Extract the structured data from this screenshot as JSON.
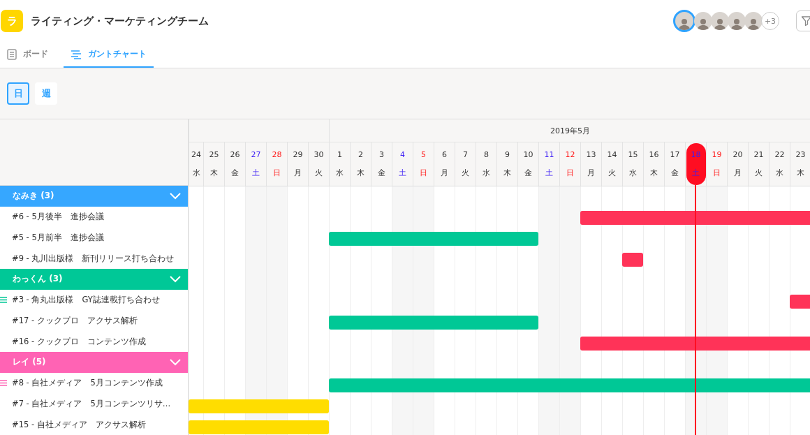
{
  "project": {
    "initial": "ラ",
    "title": "ライティング・マーケティングチーム"
  },
  "members": {
    "avatars": [
      {
        "selected": true
      },
      {
        "selected": false
      },
      {
        "selected": false
      },
      {
        "selected": false
      },
      {
        "selected": false
      }
    ],
    "more": "+3"
  },
  "tabs": [
    {
      "label": "ボード",
      "selected": false
    },
    {
      "label": "ガントチャート",
      "selected": true
    }
  ],
  "scale_buttons": [
    {
      "label": "日",
      "selected": true
    },
    {
      "label": "週",
      "selected": false
    }
  ],
  "months": [
    {
      "days": [
        {
          "day": "24",
          "weekday": "水",
          "kind": "weekday",
          "today": false
        },
        {
          "day": "25",
          "weekday": "木",
          "kind": "weekday",
          "today": false
        },
        {
          "day": "26",
          "weekday": "金",
          "kind": "weekday",
          "today": false
        },
        {
          "day": "27",
          "weekday": "土",
          "kind": "saturday",
          "today": false
        },
        {
          "day": "28",
          "weekday": "日",
          "kind": "sunday",
          "today": false
        },
        {
          "day": "29",
          "weekday": "月",
          "kind": "weekday",
          "today": false
        },
        {
          "day": "30",
          "weekday": "火",
          "kind": "weekday",
          "today": false
        }
      ]
    },
    {
      "label": "2019年5月",
      "days": [
        {
          "day": "1",
          "weekday": "水",
          "kind": "weekday",
          "today": false
        },
        {
          "day": "2",
          "weekday": "木",
          "kind": "weekday",
          "today": false
        },
        {
          "day": "3",
          "weekday": "金",
          "kind": "weekday",
          "today": false
        },
        {
          "day": "4",
          "weekday": "土",
          "kind": "saturday",
          "today": false
        },
        {
          "day": "5",
          "weekday": "日",
          "kind": "sunday",
          "today": false
        },
        {
          "day": "6",
          "weekday": "月",
          "kind": "weekday",
          "today": false
        },
        {
          "day": "7",
          "weekday": "火",
          "kind": "weekday",
          "today": false
        },
        {
          "day": "8",
          "weekday": "水",
          "kind": "weekday",
          "today": false
        },
        {
          "day": "9",
          "weekday": "木",
          "kind": "weekday",
          "today": false
        },
        {
          "day": "10",
          "weekday": "金",
          "kind": "weekday",
          "today": false
        },
        {
          "day": "11",
          "weekday": "土",
          "kind": "saturday",
          "today": false
        },
        {
          "day": "12",
          "weekday": "日",
          "kind": "sunday",
          "today": false
        },
        {
          "day": "13",
          "weekday": "月",
          "kind": "weekday",
          "today": false
        },
        {
          "day": "14",
          "weekday": "火",
          "kind": "weekday",
          "today": false
        },
        {
          "day": "15",
          "weekday": "水",
          "kind": "weekday",
          "today": false
        },
        {
          "day": "16",
          "weekday": "木",
          "kind": "weekday",
          "today": false
        },
        {
          "day": "17",
          "weekday": "金",
          "kind": "weekday",
          "today": false
        },
        {
          "day": "18",
          "weekday": "土",
          "kind": "saturday",
          "today": true
        },
        {
          "day": "19",
          "weekday": "日",
          "kind": "sunday",
          "today": false
        },
        {
          "day": "20",
          "weekday": "月",
          "kind": "weekday",
          "today": false
        },
        {
          "day": "21",
          "weekday": "火",
          "kind": "weekday",
          "today": false
        },
        {
          "day": "22",
          "weekday": "水",
          "kind": "weekday",
          "today": false
        },
        {
          "day": "23",
          "weekday": "木",
          "kind": "weekday",
          "today": false
        }
      ]
    }
  ],
  "groups": [
    {
      "label": "なみき (3)",
      "color": "#36a7ff",
      "expanded": true,
      "tasks": [
        {
          "title": "#6 - 5月後半　進捗会議",
          "handle": false,
          "bar": {
            "color": "#ff3358"
          }
        },
        {
          "title": "#5 - 5月前半　進捗会議",
          "handle": false,
          "bar": {
            "color": "#00c896"
          }
        },
        {
          "title": "#9 - 丸川出版様　新刊リリース打ち合わせ",
          "handle": false,
          "bar": {
            "color": "#ff3358"
          }
        }
      ]
    },
    {
      "label": "わっくん (3)",
      "color": "#00c897",
      "expanded": true,
      "tasks": [
        {
          "title": "#3 - 角丸出版様　GY誌連載打ち合わせ",
          "handle": true,
          "bar": {
            "color": "#ff3358"
          }
        },
        {
          "title": "#17 - クックプロ　アクサス解析",
          "handle": false,
          "bar": {
            "color": "#00c896"
          }
        },
        {
          "title": "#16 - クックプロ　コンテンツ作成",
          "handle": false,
          "bar": {
            "color": "#ff3358"
          }
        }
      ]
    },
    {
      "label": "レイ (5)",
      "color": "#ff63b4",
      "expanded": true,
      "tasks": [
        {
          "title": "#8 - 自社メディア　5月コンテンツ作成",
          "handle": true,
          "bar": {
            "color": "#00c896"
          }
        },
        {
          "title": "#7 - 自社メディア　5月コンテンツリサ…",
          "handle": false,
          "bar": {
            "color": "#ffdd00"
          }
        },
        {
          "title": "#15 - 自社メディア　アクサス解析",
          "handle": false,
          "bar": {
            "color": "#ffdd00"
          }
        }
      ]
    }
  ]
}
